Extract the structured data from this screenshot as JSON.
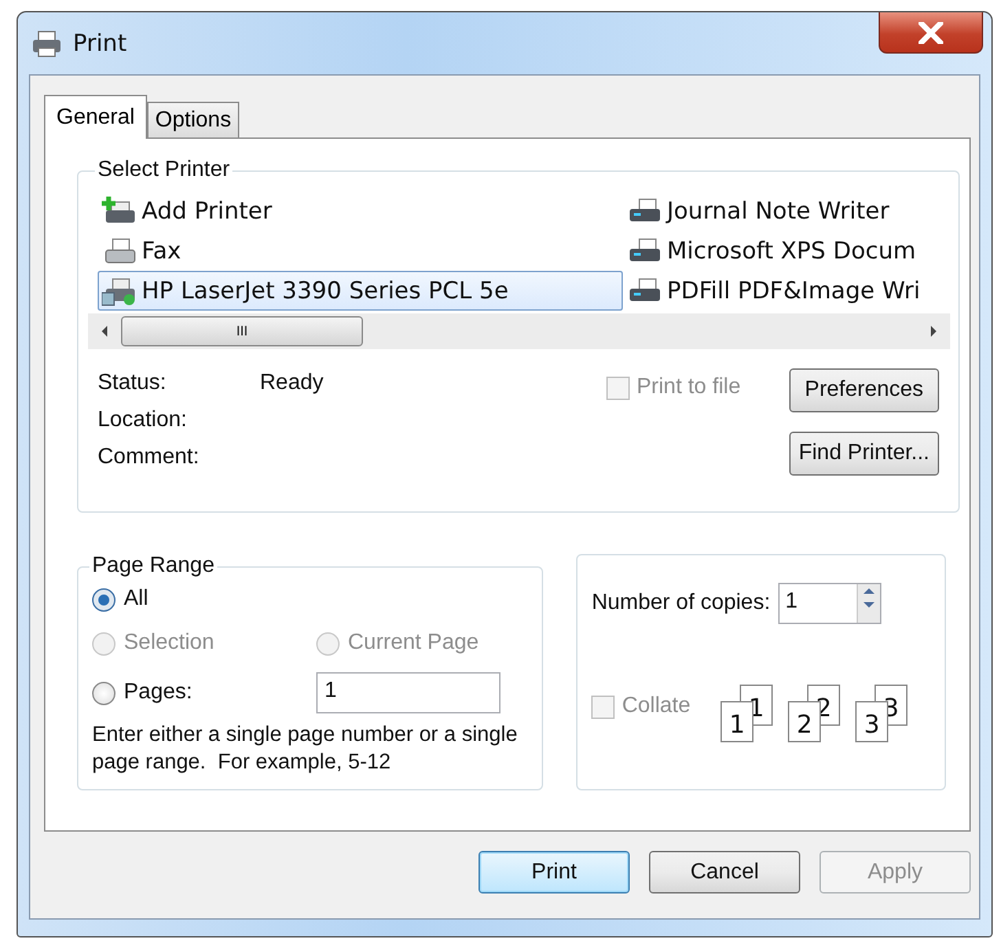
{
  "window": {
    "title": "Print"
  },
  "tabs": [
    {
      "label": "General",
      "selected": true
    },
    {
      "label": "Options",
      "selected": false
    }
  ],
  "select_printer": {
    "title": "Select Printer",
    "printers": [
      {
        "name": "Add Printer",
        "kind": "add",
        "selected": false
      },
      {
        "name": "Fax",
        "kind": "fax",
        "selected": false
      },
      {
        "name": "HP LaserJet 3390 Series PCL 5e",
        "kind": "network",
        "selected": true
      },
      {
        "name": "Journal Note Writer",
        "kind": "printer",
        "selected": false
      },
      {
        "name": "Microsoft XPS Docum",
        "kind": "printer",
        "selected": false
      },
      {
        "name": "PDFill PDF&Image Wri",
        "kind": "printer",
        "selected": false
      }
    ],
    "scroll_thumb": "III",
    "status_label": "Status:",
    "status": "Ready",
    "location_label": "Location:",
    "comment_label": "Comment:",
    "print_to_file": {
      "label": "Print to file",
      "checked": false,
      "disabled": true
    },
    "buttons": [
      "Preferences",
      "Find Printer..."
    ]
  },
  "page_range": {
    "title": "Page Range",
    "options": [
      {
        "label": "All",
        "selected": true,
        "disabled": false
      },
      {
        "label": "Selection",
        "selected": false,
        "disabled": true
      },
      {
        "label": "Current Page",
        "selected": false,
        "disabled": true
      },
      {
        "label": "Pages:",
        "selected": false,
        "disabled": false
      }
    ],
    "pages_value": "1",
    "hint": "Enter either a single page number or a single page range.  For example, 5-12"
  },
  "copies": {
    "label": "Number of copies:",
    "value": "1",
    "collate": {
      "label": "Collate",
      "checked": false,
      "disabled": true
    },
    "collate_sets": [
      {
        "front": "1",
        "back": "1"
      },
      {
        "front": "2",
        "back": "2"
      },
      {
        "front": "3",
        "back": "3"
      }
    ]
  },
  "buttons": [
    {
      "label": "Print",
      "kind": "default",
      "disabled": false
    },
    {
      "label": "Cancel",
      "kind": "normal",
      "disabled": false
    },
    {
      "label": "Apply",
      "kind": "normal",
      "disabled": true
    }
  ]
}
